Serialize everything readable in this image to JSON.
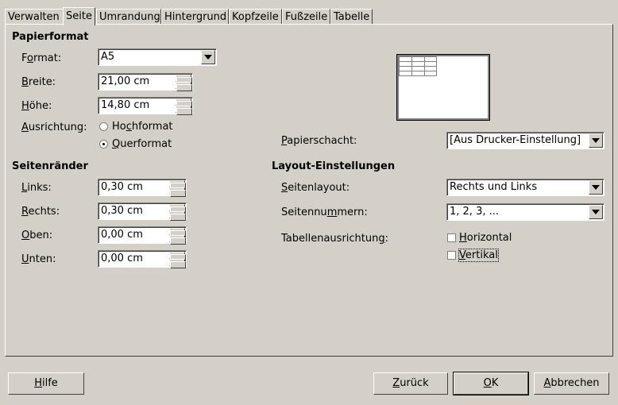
{
  "tabs": [
    "Verwalten",
    "Seite",
    "Umrandung",
    "Hintergrund",
    "Kopfzeile",
    "Fußzeile",
    "Tabelle"
  ],
  "active_tab": "Seite",
  "paper_format": {
    "title": "Papierformat",
    "format_label_pre": "F",
    "format_label_u": "o",
    "format_label_post": "rmat:",
    "format_value": "A5",
    "width_label_u": "B",
    "width_label_post": "reite:",
    "width_value": "21,00 cm",
    "height_label_u": "H",
    "height_label_post": "öhe:",
    "height_value": "14,80 cm",
    "orientation_label_u": "A",
    "orientation_label_post": "usrichtung:",
    "portrait_pre": "Ho",
    "portrait_u": "c",
    "portrait_post": "hformat",
    "landscape_u": "Q",
    "landscape_post": "uerformat",
    "selected_orientation": "Querformat"
  },
  "margins": {
    "title": "Seitenränder",
    "left_label_u": "L",
    "left_label_post": "inks:",
    "left_value": "0,30 cm",
    "right_label_u": "R",
    "right_label_post": "echts:",
    "right_value": "0,30 cm",
    "top_label_u": "O",
    "top_label_post": "ben:",
    "top_value": "0,00 cm",
    "bottom_label_u": "U",
    "bottom_label_post": "nten:",
    "bottom_value": "0,00 cm"
  },
  "paper_tray": {
    "label_u": "P",
    "label_post": "apierschacht:",
    "value": "[Aus Drucker-Einstellung]"
  },
  "layout": {
    "title": "Layout-Einstellungen",
    "page_layout_label_u": "S",
    "page_layout_label_post": "eitenlayout:",
    "page_layout_value": "Rechts und Links",
    "numbering_label_pre": "Seitennu",
    "numbering_label_u": "m",
    "numbering_label_post": "mern:",
    "numbering_value": "1, 2, 3, ...",
    "table_alignment_label_pre": "Tabellenausrichtun",
    "table_alignment_label_u": "g",
    "table_alignment_label_post": ":",
    "horizontal_u": "H",
    "horizontal_post": "orizontal",
    "vertical_u": "V",
    "vertical_post": "ertikal"
  },
  "buttons": {
    "help_u": "H",
    "help_post": "ilfe",
    "back_pre": "",
    "back_u": "Z",
    "back_post": "urück",
    "ok_u": "O",
    "ok_post": "K",
    "cancel_pre": "",
    "cancel_u": "A",
    "cancel_post": "bbrechen"
  }
}
